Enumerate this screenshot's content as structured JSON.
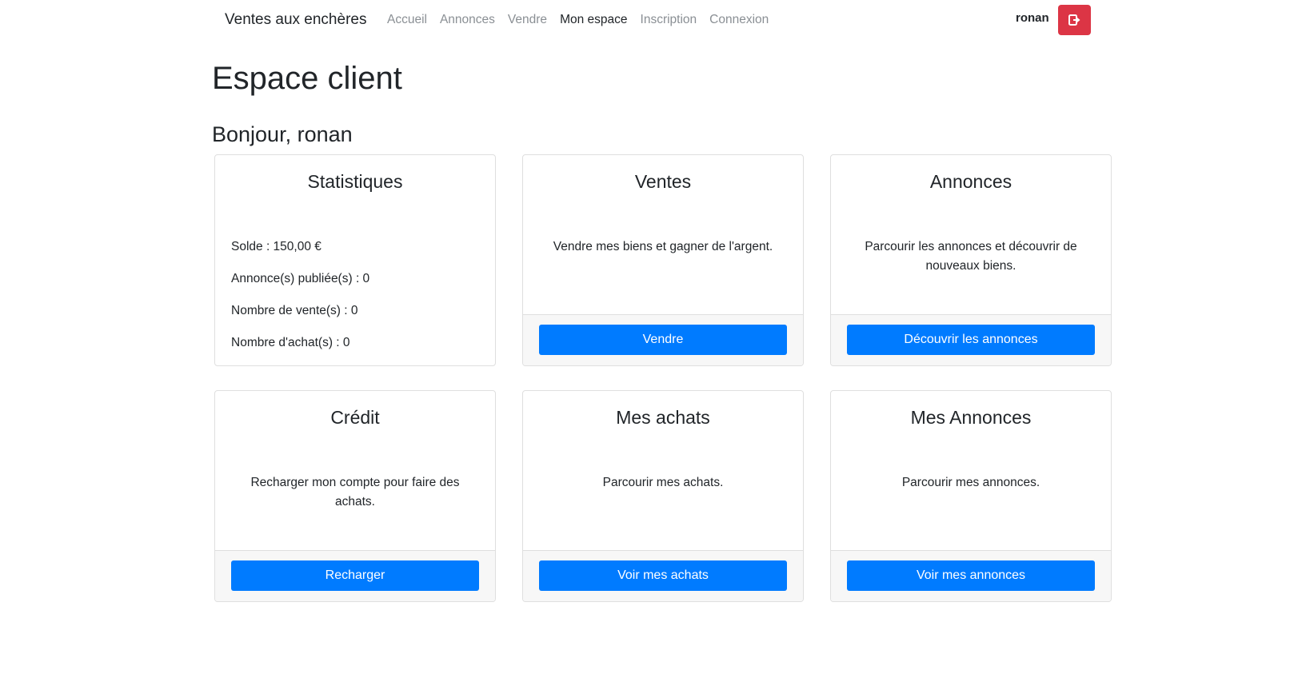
{
  "nav": {
    "brand": "Ventes aux enchères",
    "links": [
      "Accueil",
      "Annonces",
      "Vendre",
      "Mon espace",
      "Inscription",
      "Connexion"
    ],
    "user": "ronan",
    "logout_icon": "sign-out-icon"
  },
  "page": {
    "title": "Espace client",
    "greeting": "Bonjour, ronan"
  },
  "stats": {
    "title": "Statistiques",
    "lines": [
      "Solde : 150,00 €",
      "Annonce(s) publiée(s) : 0",
      "Nombre de vente(s) : 0",
      "Nombre d'achat(s) : 0"
    ]
  },
  "cards": [
    {
      "title": "Ventes",
      "text": "Vendre mes biens et gagner de l'argent.",
      "button": "Vendre"
    },
    {
      "title": "Annonces",
      "text": "Parcourir les annonces et découvrir de nouveaux biens.",
      "button": "Découvrir les annonces"
    },
    {
      "title": "Crédit",
      "text": "Recharger mon compte pour faire des achats.",
      "button": "Recharger"
    },
    {
      "title": "Mes achats",
      "text": "Parcourir mes achats.",
      "button": "Voir mes achats"
    },
    {
      "title": "Mes Annonces",
      "text": "Parcourir mes annonces.",
      "button": "Voir mes annonces"
    }
  ],
  "colors": {
    "primary": "#007bff",
    "danger": "#dc3545"
  }
}
